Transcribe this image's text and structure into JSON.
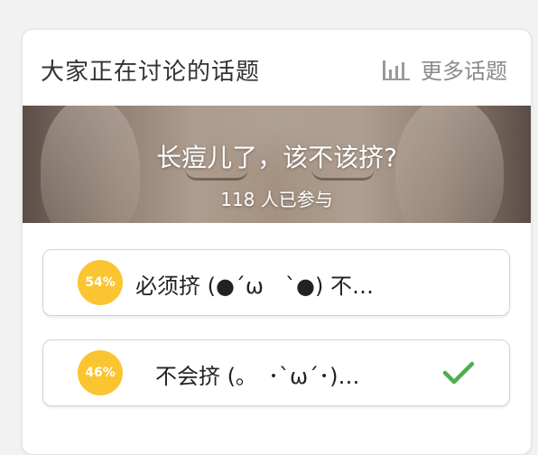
{
  "widget": {
    "title": "大家正在讨论的话题",
    "more_label": "更多话题"
  },
  "topic": {
    "question": "长痘儿了，该不该挤?",
    "participants": "118 人已参与"
  },
  "options": [
    {
      "percent": "54%",
      "label": "必须挤 (●´ω　`●) 不…",
      "selected": false
    },
    {
      "percent": "46%",
      "label": "不会挤 (｡　･`ω´･)…",
      "selected": true
    }
  ],
  "icons": {
    "more": "bar-chart-icon",
    "selected": "checkmark-icon"
  },
  "colors": {
    "percent_badge": "#fbc531",
    "checkmark": "#4caf50",
    "muted_text": "#8a8a8a"
  }
}
